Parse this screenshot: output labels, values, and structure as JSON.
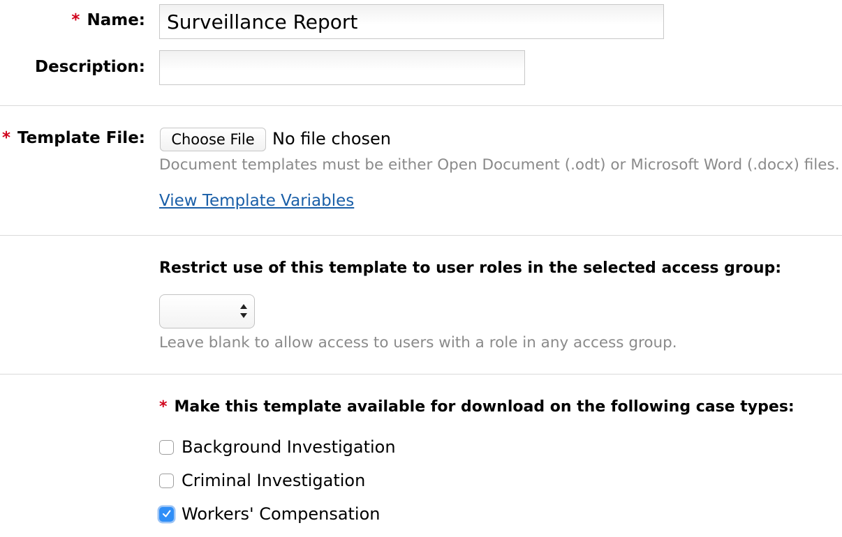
{
  "form": {
    "name": {
      "required_mark": "*",
      "label": "Name:",
      "value": "Surveillance Report"
    },
    "description": {
      "label": "Description:",
      "value": ""
    },
    "template_file": {
      "required_mark": "*",
      "label": "Template File:",
      "button_label": "Choose File",
      "status": "No file chosen",
      "help": "Document templates must be either Open Document (.odt) or Microsoft Word (.docx) files.",
      "link_label": "View Template Variables"
    },
    "access_group": {
      "heading": "Restrict use of this template to user roles in the selected access group:",
      "selected_value": "",
      "help": "Leave blank to allow access to users with a role in any access group."
    },
    "case_types": {
      "required_mark": "*",
      "heading": "Make this template available for download on the following case types:",
      "options": [
        {
          "label": "Background Investigation",
          "checked": false
        },
        {
          "label": "Criminal Investigation",
          "checked": false
        },
        {
          "label": "Workers' Compensation",
          "checked": true
        }
      ]
    }
  },
  "colors": {
    "required": "#d0021b",
    "link": "#1a5fa8",
    "help_text": "#8a8a8a",
    "checkbox_checked": "#2f8ef7"
  },
  "icons": {
    "select_arrows": "updown-arrows-icon",
    "checkbox_tick": "checkmark-icon"
  }
}
